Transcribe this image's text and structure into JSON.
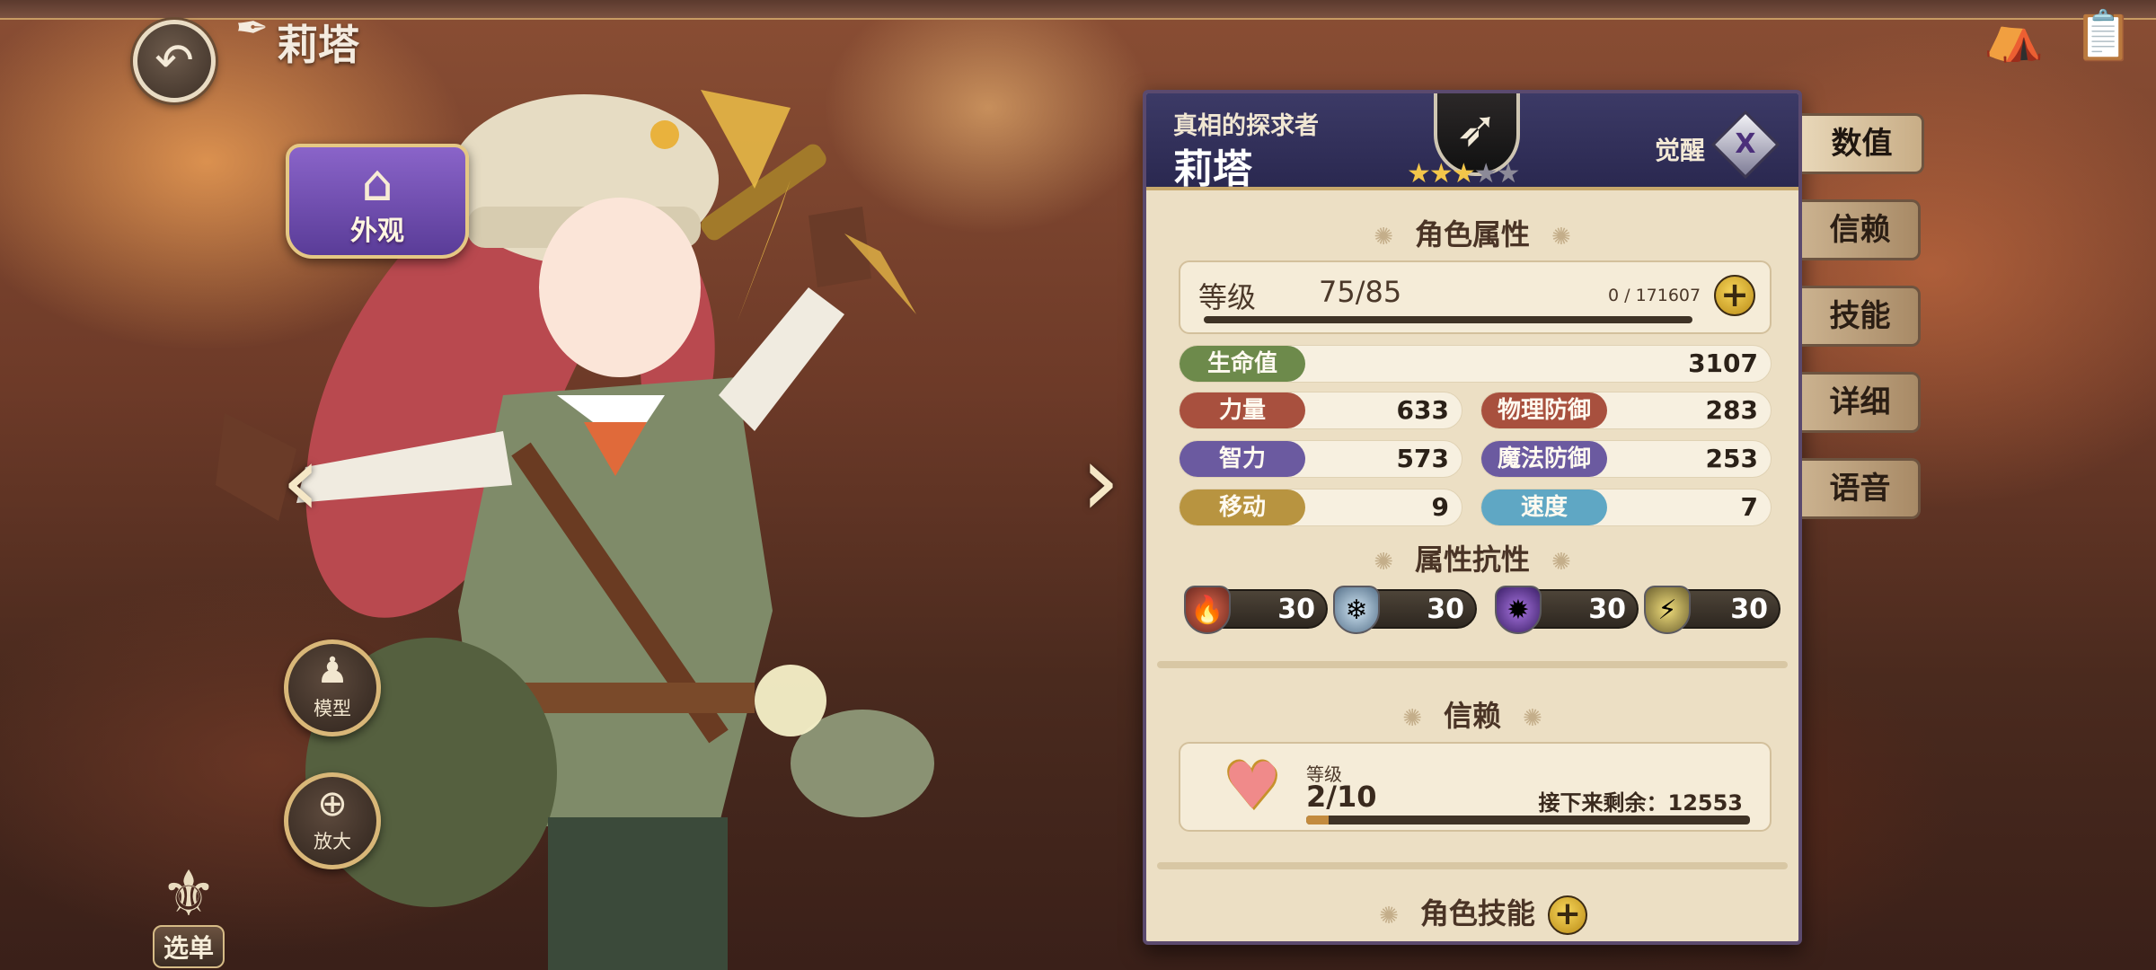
{
  "header": {
    "character_name": "莉塔"
  },
  "left_controls": {
    "wardrobe_label": "外观",
    "model_label": "模型",
    "zoom_label": "放大",
    "menu_label": "选单"
  },
  "panel": {
    "subtitle": "真相的探求者",
    "name": "莉塔",
    "stars_filled": 3,
    "stars_total": 5,
    "awaken_label": "觉醒",
    "awaken_icon": "Ⅹ",
    "attributes_title": "角色属性",
    "level": {
      "label": "等级",
      "value": "75/85",
      "exp": "0 / 171607"
    },
    "stats": {
      "hp": {
        "label": "生命值",
        "value": "3107",
        "color": "#6d8a4b"
      },
      "str": {
        "label": "力量",
        "value": "633",
        "color": "#a8503e"
      },
      "pdef": {
        "label": "物理防御",
        "value": "283",
        "color": "#a8503e"
      },
      "int": {
        "label": "智力",
        "value": "573",
        "color": "#6b5aa0"
      },
      "mdef": {
        "label": "魔法防御",
        "value": "253",
        "color": "#6b5aa0"
      },
      "move": {
        "label": "移动",
        "value": "9",
        "color": "#b89440"
      },
      "speed": {
        "label": "速度",
        "value": "7",
        "color": "#5fa7c4"
      }
    },
    "resistance_title": "属性抗性",
    "resistances": [
      {
        "icon": "fire-shield-icon",
        "value": "30",
        "color": "#c44a3a"
      },
      {
        "icon": "ice-shield-icon",
        "value": "30",
        "color": "#8fb5d4"
      },
      {
        "icon": "dark-shield-icon",
        "value": "30",
        "color": "#7a45b8"
      },
      {
        "icon": "lightning-shield-icon",
        "value": "30",
        "color": "#c9b44a"
      }
    ],
    "trust_title": "信赖",
    "trust": {
      "label": "等级",
      "value": "2/10",
      "remaining": "接下来剩余：12553",
      "progress_percent": 5
    },
    "skills_title": "角色技能"
  },
  "side_tabs": [
    "数值",
    "信赖",
    "技能",
    "详细",
    "语音"
  ],
  "colors": {
    "panel_header": "#2f2d58",
    "panel_body": "#ecdfc4",
    "accent_gold": "#e6c07a"
  }
}
